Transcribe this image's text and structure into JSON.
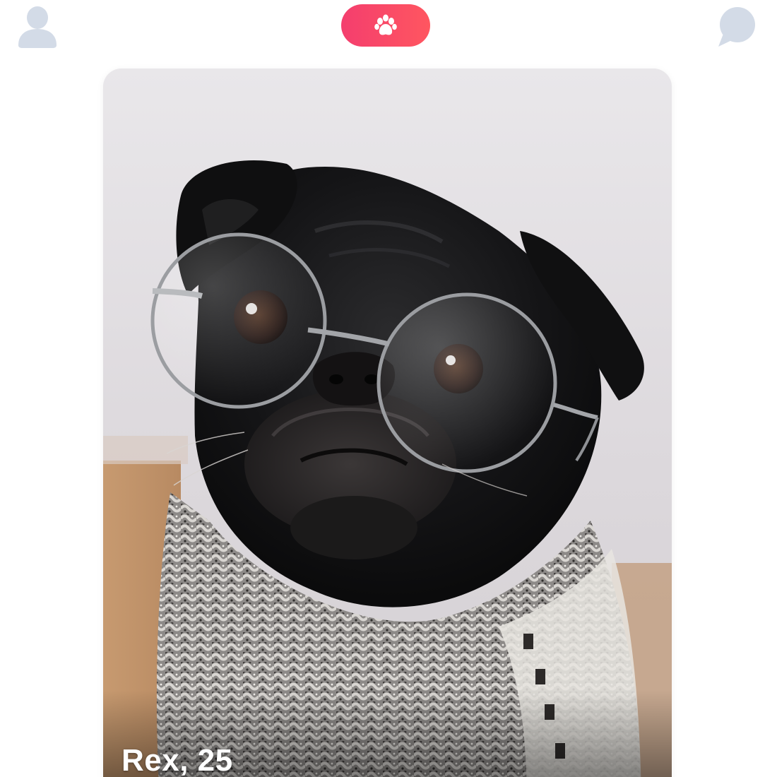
{
  "colors": {
    "accent_start": "#f43e6e",
    "accent_end": "#ff5660",
    "icon_inactive": "#d3dbe7",
    "icon_on_accent": "#ffffff",
    "card_text": "#ffffff"
  },
  "topbar": {
    "profile_icon": "person-icon",
    "home_icon": "paw-icon",
    "home_active": true,
    "chat_icon": "chat-bubble-icon"
  },
  "card": {
    "image": "pug-with-round-glasses-photo",
    "caption": "Rex, 25"
  }
}
